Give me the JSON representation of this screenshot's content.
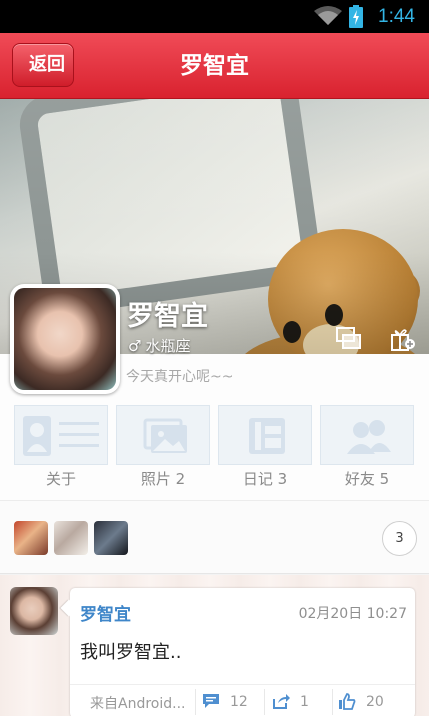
{
  "status_bar": {
    "time": "1:44",
    "accent": "#33b5e5"
  },
  "header": {
    "back_label": "返回",
    "title": "罗智宜",
    "color": "#e0303c"
  },
  "profile": {
    "name": "罗智宜",
    "gender_symbol": "♂",
    "zodiac": "水瓶座",
    "status": "今天真开心呢~~",
    "cover_actions": [
      "photo-change-icon",
      "gift-icon"
    ]
  },
  "tabs": [
    {
      "label": "关于",
      "icon": "profile-card-icon"
    },
    {
      "label": "照片 2",
      "icon": "photo-icon"
    },
    {
      "label": "日记 3",
      "icon": "diary-icon"
    },
    {
      "label": "好友 5",
      "icon": "friends-icon"
    }
  ],
  "friends": {
    "count": "3"
  },
  "post": {
    "author": "罗智宜",
    "time": "02月20日 10:27",
    "text": "我叫罗智宜..",
    "source": "来自Android...",
    "comments": "12",
    "shares": "1",
    "likes": "20"
  }
}
